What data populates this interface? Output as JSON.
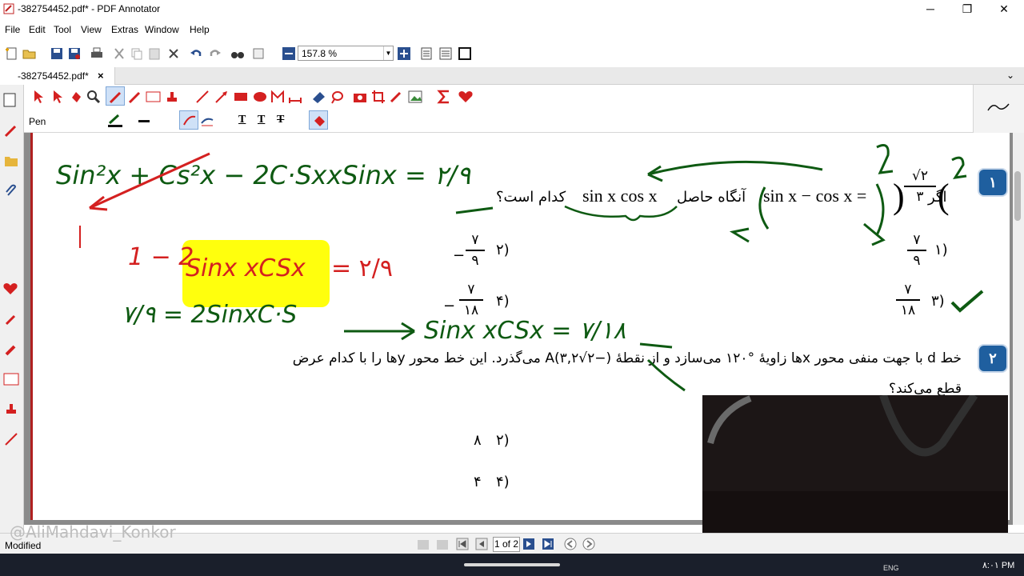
{
  "window": {
    "title": "-382754452.pdf* - PDF Annotator",
    "minimize": "─",
    "maximize": "❐",
    "close": "✕"
  },
  "menu": [
    "File",
    "Edit",
    "Tool",
    "View",
    "Extras",
    "Window",
    "Help"
  ],
  "toolbar": {
    "zoom": "157.8 %"
  },
  "tab": {
    "label": "-382754452.pdf*",
    "close": "×"
  },
  "annotation_toolbar": {
    "tool_label": "Pen",
    "text_tools": [
      "T",
      "T",
      "T"
    ]
  },
  "colors": {
    "accent_blue": "#1f5f9f",
    "ink_green": "#0e5a12",
    "ink_red": "#d42020",
    "highlight": "#ffff00",
    "sidebar_red": "#d42020"
  },
  "questions": [
    {
      "number": "۱",
      "text_prefix": "اگر",
      "text_mid": "آنگاه حاصل",
      "text_end": "کدام است؟",
      "math_1": "sin x − cos x =",
      "math_2": "sin x cos x",
      "given_num": "√۲",
      "given_den": "۳",
      "options": [
        {
          "num": "۱)",
          "value_num": "۷",
          "value_den": "۹",
          "sign": ""
        },
        {
          "num": "۲)",
          "value_num": "۷",
          "value_den": "۹",
          "sign": "−"
        },
        {
          "num": "۳)",
          "value_num": "۷",
          "value_den": "۱۸",
          "sign": ""
        },
        {
          "num": "۴)",
          "value_num": "۷",
          "value_den": "۱۸",
          "sign": "−"
        }
      ]
    },
    {
      "number": "۲",
      "line1": "خط d با جهت منفی محور xها زاویهٔ °۱۲۰ می‌سازد و از نقطهٔ (−۲√۳,۲)A می‌گذرد. این خط محور yها را با کدام عرض",
      "line2": "قطع می‌کند؟",
      "options": [
        {
          "num": "۲)",
          "value": "۸"
        },
        {
          "num": "۴)",
          "value": "۴"
        }
      ]
    }
  ],
  "handwriting": {
    "line1": "Sin²x + Cs²x − 2C·SxxSinx = ۲/۹",
    "line2_red": "1 − 2",
    "highlighted": "Sinx xCSx",
    "line2_eq": "= ۲/۹",
    "line3_left": "۷/۹ = 2SinxC·S",
    "line3_right": "Sinx xCSx = ۷/۱۸"
  },
  "status": {
    "text": "Modified",
    "watermark": "@AliMahdavi_Konkor",
    "page_indicator": "1 of 2"
  },
  "taskbar": {
    "lang": "ENG",
    "time": "۸:۰۱ PM"
  }
}
